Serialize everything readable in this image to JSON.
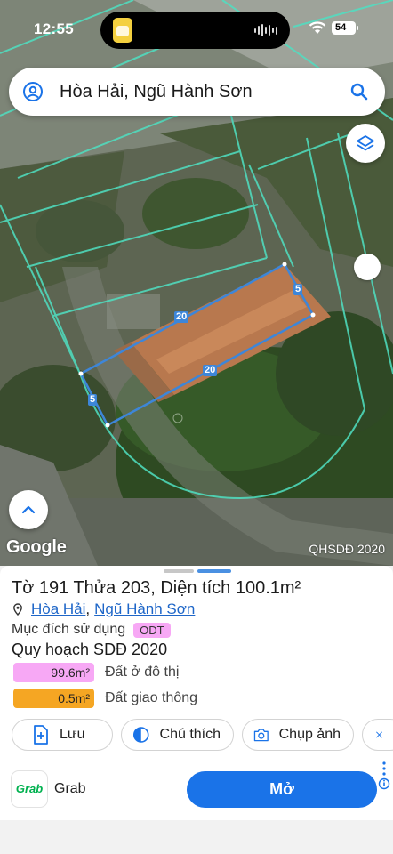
{
  "status_bar": {
    "time": "12:55",
    "battery": "54"
  },
  "search": {
    "query": "Hòa Hải, Ngũ Hành Sơn"
  },
  "map": {
    "logo": "Google",
    "source": "QHSDĐ 2020",
    "dimension_labels": [
      "20",
      "20",
      "5",
      "5"
    ],
    "parcel_outline_color": "#3d86d9",
    "boundary_color": "#4fe0c2"
  },
  "parcel": {
    "title": "Tờ 191 Thửa 203, Diện tích 100.1m²",
    "ward": "Hòa Hải",
    "district": "Ngũ Hành Sơn",
    "purpose_label": "Mục đích sử dụng",
    "purpose_code": "ODT",
    "plan_title": "Quy hoạch SDĐ 2020",
    "areas": [
      {
        "value": "99.6m²",
        "label": "Đất ở đô thị",
        "color": "#f7a8f5",
        "fraction": 1.0
      },
      {
        "value": "0.5m²",
        "label": "Đất giao thông",
        "color": "#f5a623",
        "fraction": 1.0
      }
    ]
  },
  "actions": {
    "save": "Lưu",
    "legend": "Chú thích",
    "screenshot": "Chụp ảnh"
  },
  "ad": {
    "logo": "Grab",
    "name": "Grab",
    "cta": "Mở"
  },
  "icons": [
    "account-icon",
    "search-icon",
    "layers-icon",
    "chevron-up-icon",
    "pin-icon",
    "add-doc-icon",
    "half-circle-icon",
    "camera-icon",
    "measure-icon",
    "info-icon"
  ]
}
